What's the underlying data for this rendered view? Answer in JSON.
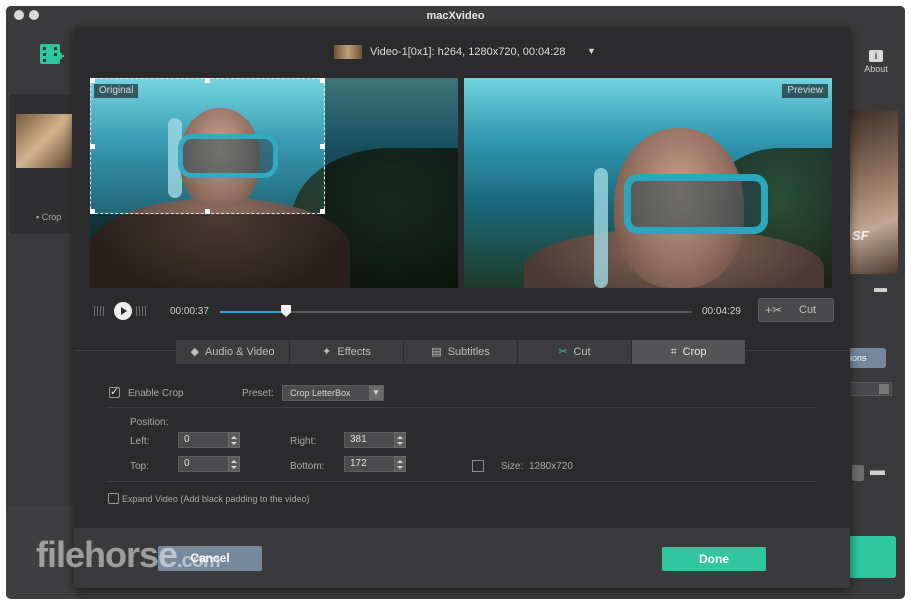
{
  "window": {
    "title": "macXvideo"
  },
  "background": {
    "about_label": "About",
    "crop_label": "Crop",
    "thumb_text": "SF",
    "options_label": "ions"
  },
  "video_header": {
    "label": "Video-1[0x1]: h264, 1280x720, 00:04:28"
  },
  "preview": {
    "original_label": "Original",
    "preview_label": "Preview"
  },
  "timeline": {
    "current_time": "00:00:37",
    "total_time": "00:04:29",
    "progress": 0.14,
    "cut_label": "Cut"
  },
  "tabs": [
    {
      "label": "Audio & Video",
      "icon": "audio-video-icon"
    },
    {
      "label": "Effects",
      "icon": "magic-wand-icon"
    },
    {
      "label": "Subtitles",
      "icon": "keyboard-icon"
    },
    {
      "label": "Cut",
      "icon": "scissors-icon"
    },
    {
      "label": "Crop",
      "icon": "crop-icon",
      "active": true
    }
  ],
  "crop": {
    "enable_label": "Enable Crop",
    "enabled": true,
    "preset_label": "Preset:",
    "preset_value": "Crop LetterBox",
    "position_label": "Position:",
    "left_label": "Left:",
    "left_value": "0",
    "top_label": "Top:",
    "top_value": "0",
    "right_label": "Right:",
    "right_value": "381",
    "bottom_label": "Bottom:",
    "bottom_value": "172",
    "size_label": "Size:",
    "size_value": "1280x720",
    "expand_label": "Expand Video (Add black padding to the video)",
    "expand_checked": false
  },
  "footer": {
    "cancel_label": "Cancel",
    "done_label": "Done"
  },
  "watermark": {
    "text": "filehorse",
    "suffix": ".com"
  },
  "colors": {
    "accent_green": "#30c79e",
    "accent_blue": "#2da6df",
    "cancel_bg": "#75889c"
  }
}
